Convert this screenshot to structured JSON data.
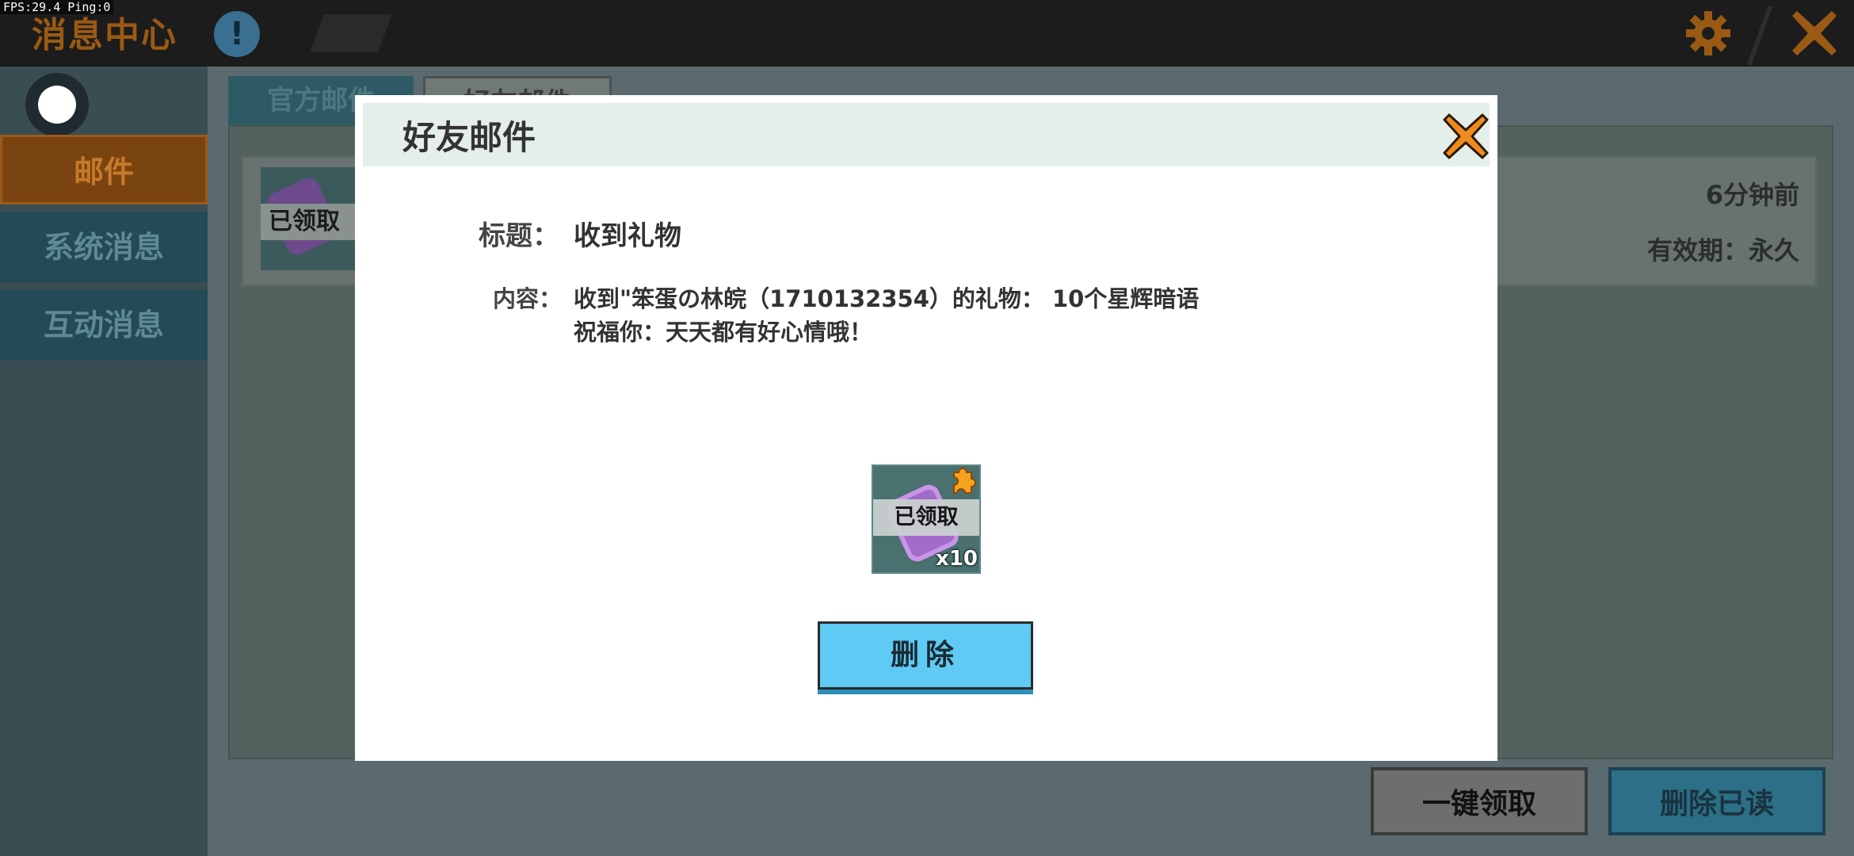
{
  "debug": {
    "fps_text": "FPS:29.4  Ping:0"
  },
  "header": {
    "title": "消息中心",
    "help_icon": "!"
  },
  "sidebar": {
    "items": [
      {
        "label": "邮件",
        "selected": true
      },
      {
        "label": "系统消息",
        "selected": false
      },
      {
        "label": "互动消息",
        "selected": false
      }
    ]
  },
  "tabs": [
    {
      "label": "官方邮件"
    },
    {
      "label": "好友邮件"
    }
  ],
  "mail_row": {
    "badge": "已领取",
    "time": "6分钟前",
    "validity": "有效期：永久"
  },
  "bottom_buttons": {
    "claim_all": "一键领取",
    "delete_read": "删除已读"
  },
  "dialog": {
    "title": "好友邮件",
    "subject_label": "标题：",
    "subject_value": "收到礼物",
    "content_label": "内容：",
    "content_line1": "收到\"笨蛋の林皖（1710132354）的礼物： 10个星辉暗语",
    "content_line2": "祝福你：天天都有好心情哦！",
    "item": {
      "badge": "已领取",
      "quantity": "x10"
    },
    "delete_label": "删除"
  },
  "colors": {
    "accent_orange": "#f08a1e",
    "button_blue": "#5fcaf4"
  }
}
